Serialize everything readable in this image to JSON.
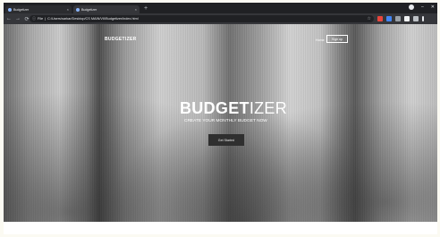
{
  "browser": {
    "tabs": [
      {
        "title": "Budgetizer",
        "close": "×"
      },
      {
        "title": "Budgetizer",
        "close": "×"
      }
    ],
    "new_tab": "+",
    "url": "C:/Users/sarkar/Desktop/CS MAIN/VII/Budgetizer/index.html",
    "url_prefix": "File",
    "nav": {
      "back": "←",
      "forward": "→",
      "reload": "⟳"
    },
    "window": {
      "minimize": "–",
      "close": "✕"
    },
    "extension_colors": [
      "#e8453c",
      "#4285f4",
      "#9aa0a6",
      "#f1f3f4",
      "#bdc1c6",
      "#e8eaed"
    ]
  },
  "site": {
    "logo": "BUDGETIZER",
    "nav": {
      "home": "Home",
      "signup": "Sign up"
    },
    "hero": {
      "title_bold": "BUDGET",
      "title_light": "IZER",
      "subtitle": "CREATE YOUR MONTHLY BUDGET NOW",
      "cta": "Get Started"
    }
  }
}
